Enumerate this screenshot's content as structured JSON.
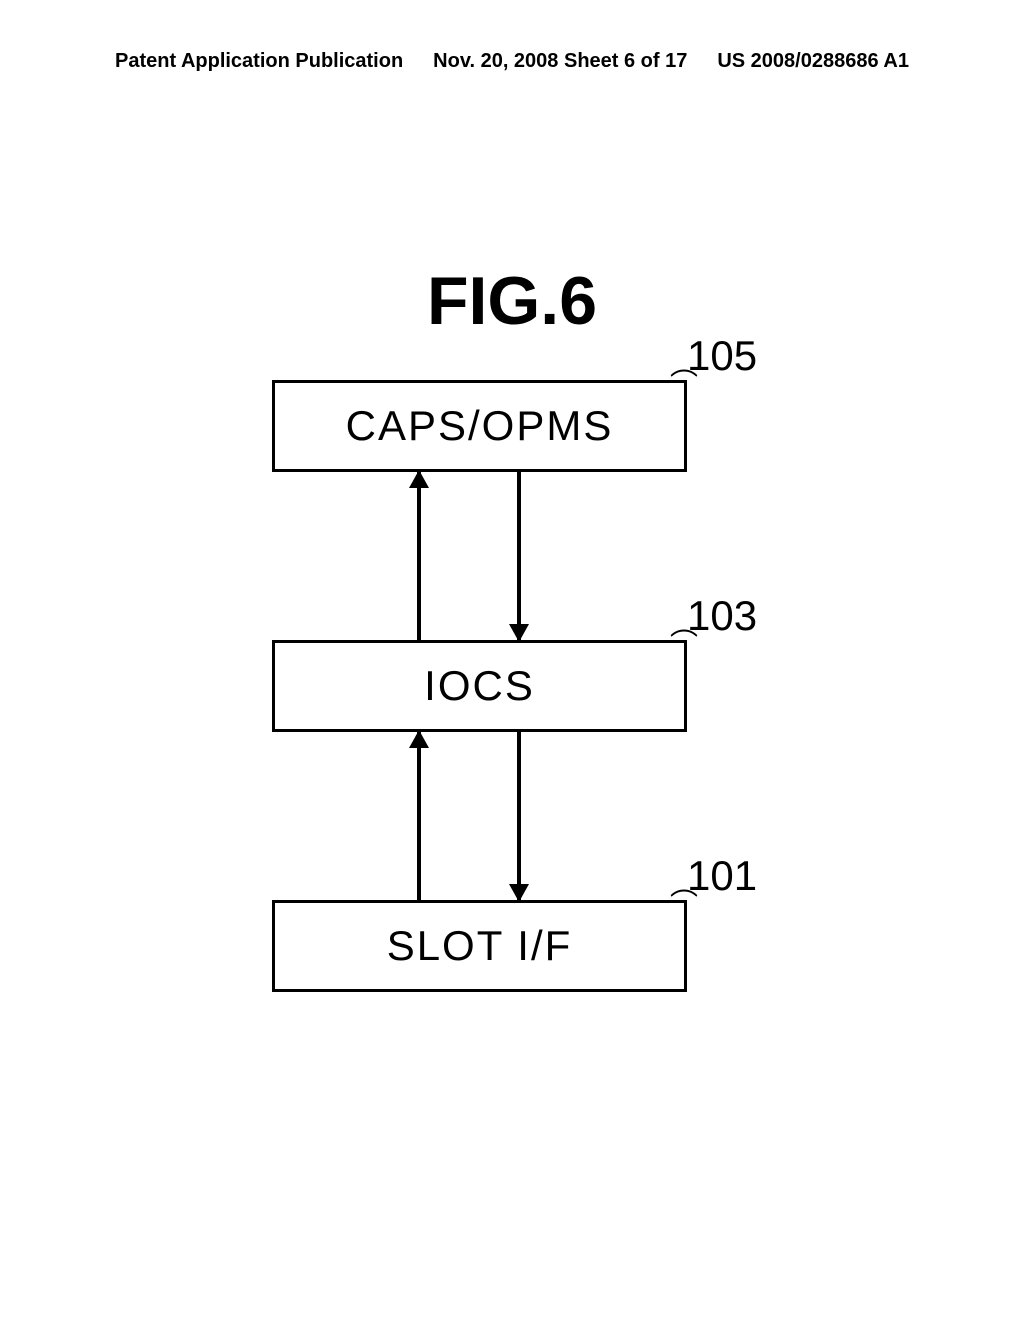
{
  "header": {
    "left": "Patent Application Publication",
    "center": "Nov. 20, 2008  Sheet 6 of 17",
    "right": "US 2008/0288686 A1"
  },
  "figure_title": "FIG.6",
  "chart_data": {
    "type": "diagram",
    "title": "FIG.6",
    "blocks": [
      {
        "id": "105",
        "label": "CAPS/OPMS",
        "position": "top"
      },
      {
        "id": "103",
        "label": "IOCS",
        "position": "middle"
      },
      {
        "id": "101",
        "label": "SLOT I/F",
        "position": "bottom"
      }
    ],
    "connections": [
      {
        "from": "105",
        "to": "103",
        "type": "bidirectional"
      },
      {
        "from": "103",
        "to": "101",
        "type": "bidirectional"
      }
    ]
  },
  "refs": {
    "r105": "105",
    "r103": "103",
    "r101": "101"
  }
}
